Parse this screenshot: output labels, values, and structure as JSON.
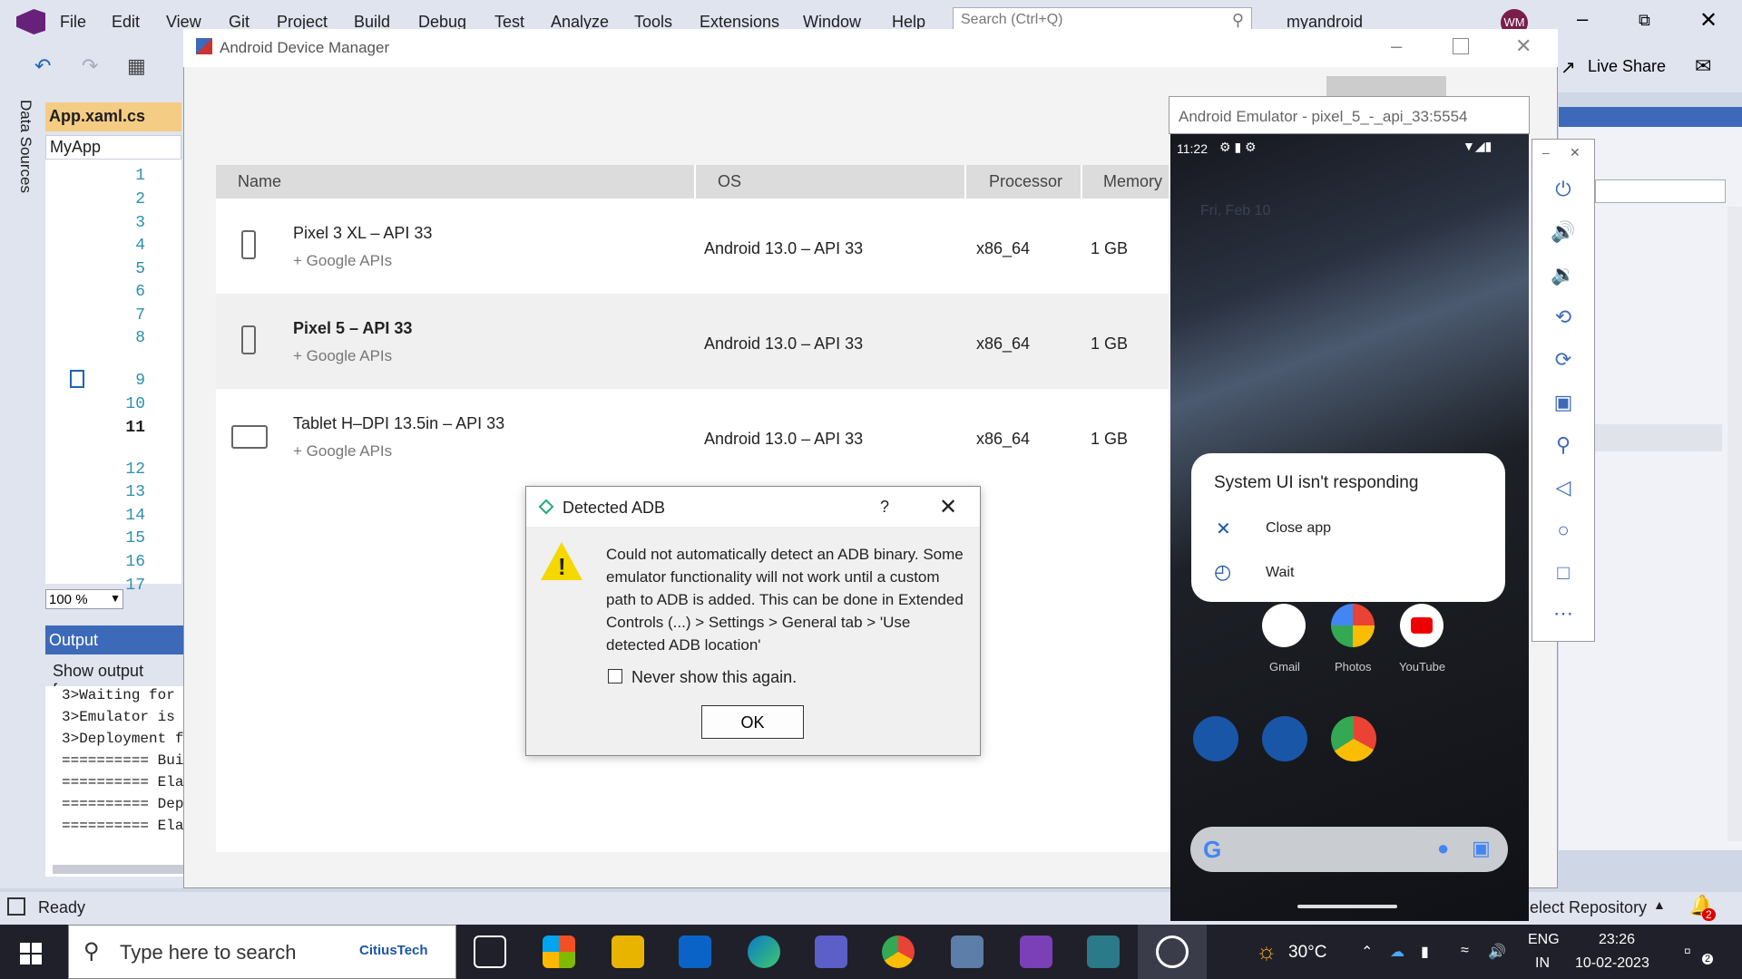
{
  "vs": {
    "menu": [
      "File",
      "Edit",
      "View",
      "Git",
      "Project",
      "Build",
      "Debug",
      "Test",
      "Analyze",
      "Tools",
      "Extensions",
      "Window",
      "Help"
    ],
    "search_placeholder": "Search (Ctrl+Q)",
    "solution_name": "myandroid",
    "user_initials": "WM",
    "live_share": "Live Share",
    "data_sources": "Data Sources",
    "editor_tab": "App.xaml.cs",
    "editor_combo": "MyApp",
    "line_numbers": [
      "1",
      "2",
      "3",
      "4",
      "5",
      "6",
      "7",
      "8",
      "9",
      "10",
      "11",
      "12",
      "13",
      "14",
      "15",
      "16",
      "17"
    ],
    "zoom": "100 %",
    "output_title": "Output",
    "output_show_from": "Show output from",
    "output_lines": [
      "3>Waiting for",
      "3>Emulator is",
      "3>Deployment f",
      "========== Bui",
      "========== Ela",
      "========== Dep",
      "========== Ela"
    ],
    "status_ready": "Ready",
    "select_repository": "elect Repository",
    "notification_count": "2"
  },
  "device_manager": {
    "title": "Android Device Manager",
    "columns": [
      "Name",
      "OS",
      "Processor",
      "Memory"
    ],
    "devices": [
      {
        "name": "Pixel 3 XL – API 33",
        "sub": "+ Google APIs",
        "os": "Android 13.0 – API 33",
        "cpu": "x86_64",
        "mem": "1 GB"
      },
      {
        "name": "Pixel 5 – API 33",
        "sub": "+ Google APIs",
        "os": "Android 13.0 – API 33",
        "cpu": "x86_64",
        "mem": "1 GB"
      },
      {
        "name": "Tablet H–DPI 13.5in – API 33",
        "sub": "+ Google APIs",
        "os": "Android 13.0 – API 33",
        "cpu": "x86_64",
        "mem": "1 GB"
      }
    ]
  },
  "dialog": {
    "title": "Detected ADB",
    "help": "?",
    "message": "Could not automatically detect an ADB binary. Some emulator functionality will not work until a custom path to ADB  is added. This can be done in Extended Controls (...) > Settings > General tab > 'Use detected ADB location'",
    "checkbox_label": "Never show this again.",
    "ok_label": "OK"
  },
  "emulator": {
    "title": "Android Emulator - pixel_5_-_api_33:5554",
    "time": "11:22",
    "date": "Fri, Feb 10",
    "anr_title": "System UI isn't responding",
    "anr_close": "Close app",
    "anr_wait": "Wait",
    "apps": [
      "Gmail",
      "Photos",
      "YouTube"
    ]
  },
  "taskbar": {
    "search_placeholder": "Type here to search",
    "citius": "CitiusTech",
    "weather": "30°C",
    "lang1": "ENG",
    "lang2": "IN",
    "time": "23:26",
    "date": "10-02-2023",
    "notif": "2"
  }
}
